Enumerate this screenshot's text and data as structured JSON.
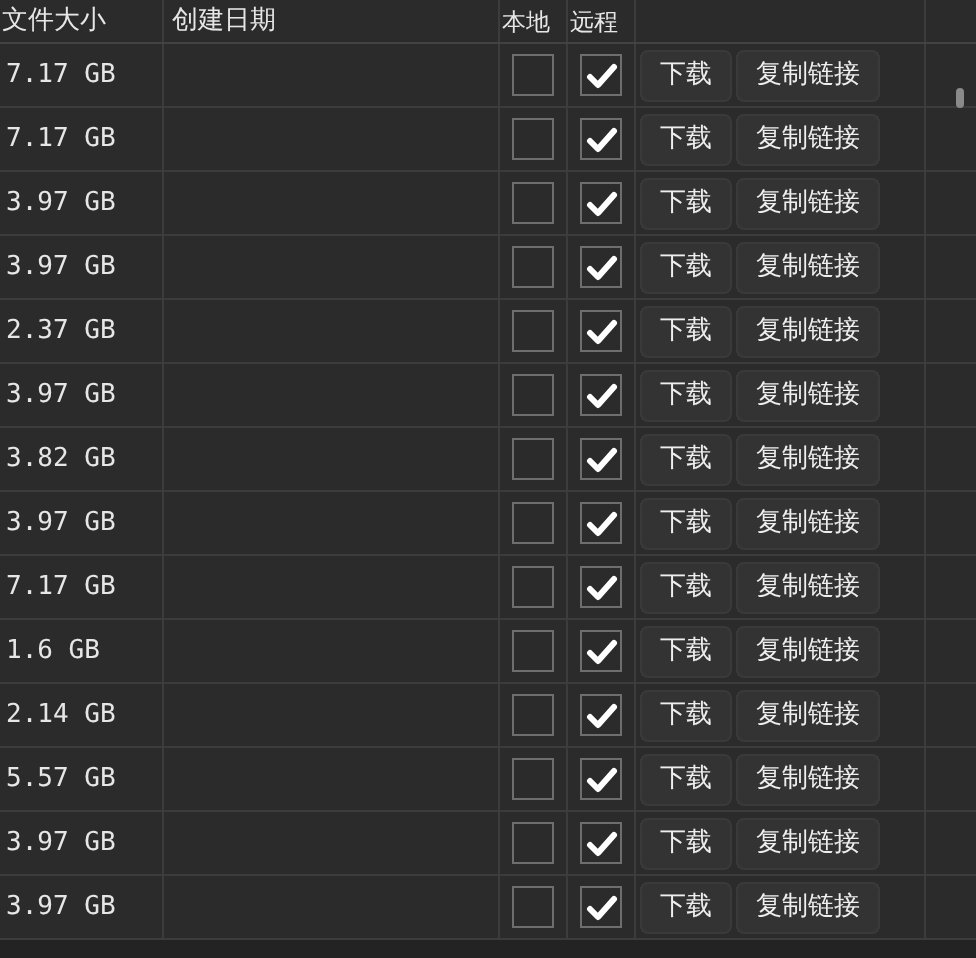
{
  "columns": [
    "文件大小",
    "创建日期",
    "本地",
    "远程"
  ],
  "rows": [
    {
      "size": "7.17 GB",
      "local": false,
      "remote": true,
      "download": "下载",
      "copy_link": "复制链接"
    },
    {
      "size": "7.17 GB",
      "local": false,
      "remote": true,
      "download": "下载",
      "copy_link": "复制链接"
    },
    {
      "size": "3.97 GB",
      "local": false,
      "remote": true,
      "download": "下载",
      "copy_link": "复制链接"
    },
    {
      "size": "3.97 GB",
      "local": false,
      "remote": true,
      "download": "下载",
      "copy_link": "复制链接"
    },
    {
      "size": "2.37 GB",
      "local": false,
      "remote": true,
      "download": "下载",
      "copy_link": "复制链接"
    },
    {
      "size": "3.97 GB",
      "local": false,
      "remote": true,
      "download": "下载",
      "copy_link": "复制链接"
    },
    {
      "size": "3.82 GB",
      "local": false,
      "remote": true,
      "download": "下载",
      "copy_link": "复制链接"
    },
    {
      "size": "3.97 GB",
      "local": false,
      "remote": true,
      "download": "下载",
      "copy_link": "复制链接"
    },
    {
      "size": "7.17 GB",
      "local": false,
      "remote": true,
      "download": "下载",
      "copy_link": "复制链接"
    },
    {
      "size": "1.6 GB",
      "local": false,
      "remote": true,
      "download": "下载",
      "copy_link": "复制链接"
    },
    {
      "size": "2.14 GB",
      "local": false,
      "remote": true,
      "download": "下载",
      "copy_link": "复制链接"
    },
    {
      "size": "5.57 GB",
      "local": false,
      "remote": true,
      "download": "下载",
      "copy_link": "复制链接"
    },
    {
      "size": "3.97 GB",
      "local": false,
      "remote": true,
      "download": "下载",
      "copy_link": "复制链接"
    },
    {
      "size": "3.97 GB",
      "local": false,
      "remote": true,
      "download": "下载",
      "copy_link": "复制链接"
    }
  ]
}
